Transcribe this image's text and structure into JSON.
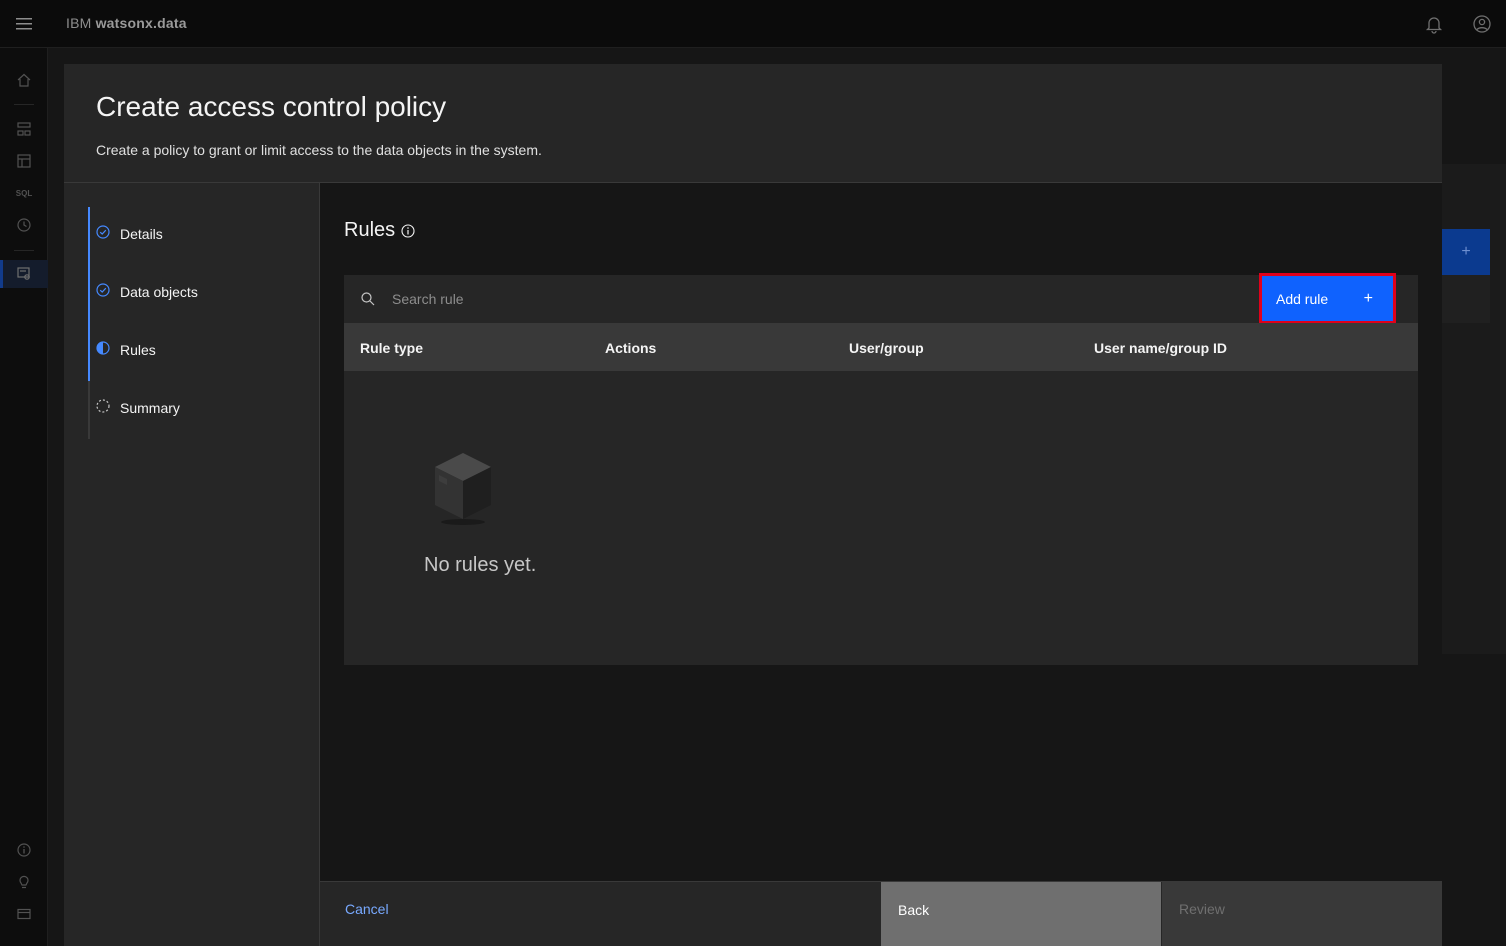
{
  "header": {
    "brand_prefix": "IBM",
    "brand_name": "watsonx.data"
  },
  "rail": {
    "sql_label": "SQL"
  },
  "modal": {
    "title": "Create access control policy",
    "description": "Create a policy to grant or limit access to the data objects in the system."
  },
  "steps": [
    {
      "label": "Details",
      "state": "complete"
    },
    {
      "label": "Data objects",
      "state": "complete"
    },
    {
      "label": "Rules",
      "state": "current"
    },
    {
      "label": "Summary",
      "state": "incomplete"
    }
  ],
  "rules": {
    "title": "Rules",
    "search_placeholder": "Search rule",
    "add_button": "Add rule",
    "add_icon": "+",
    "columns": [
      "Rule type",
      "Actions",
      "User/group",
      "User name/group ID"
    ],
    "empty_text": "No rules yet."
  },
  "footer": {
    "cancel": "Cancel",
    "back": "Back",
    "review": "Review"
  },
  "colors": {
    "primary": "#0f62fe",
    "highlight": "#e0001b",
    "link": "#78a9ff",
    "step_done": "#4589ff"
  }
}
